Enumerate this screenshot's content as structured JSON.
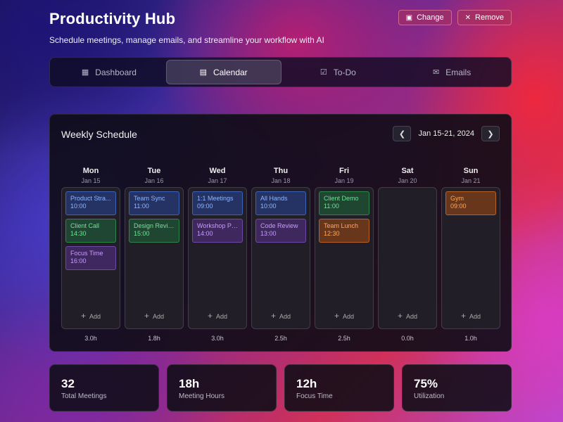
{
  "header": {
    "title": "Productivity Hub",
    "subtitle": "Schedule meetings, manage emails, and streamline your workflow with AI"
  },
  "top_buttons": {
    "change_label": "Change",
    "change_icon": "image-icon",
    "remove_label": "Remove",
    "remove_icon": "close-icon"
  },
  "tabs": [
    {
      "label": "Dashboard",
      "icon": "grid-icon",
      "active": false
    },
    {
      "label": "Calendar",
      "icon": "calendar-icon",
      "active": true
    },
    {
      "label": "To-Do",
      "icon": "checkbox-icon",
      "active": false
    },
    {
      "label": "Emails",
      "icon": "mail-icon",
      "active": false
    }
  ],
  "schedule": {
    "title": "Weekly Schedule",
    "range": "Jan 15-21, 2024",
    "add_label": "Add",
    "days": [
      {
        "name": "Mon",
        "date": "Jan 15",
        "total": "3.0h",
        "events": [
          {
            "name": "Product Stra...",
            "time": "10:00",
            "color": "blue"
          },
          {
            "name": "Client Call",
            "time": "14:30",
            "color": "green"
          },
          {
            "name": "Focus Time",
            "time": "16:00",
            "color": "purple"
          }
        ]
      },
      {
        "name": "Tue",
        "date": "Jan 16",
        "total": "1.8h",
        "events": [
          {
            "name": "Team Sync",
            "time": "11:00",
            "color": "blue"
          },
          {
            "name": "Design Review",
            "time": "15:00",
            "color": "green"
          }
        ]
      },
      {
        "name": "Wed",
        "date": "Jan 17",
        "total": "3.0h",
        "events": [
          {
            "name": "1:1 Meetings",
            "time": "09:00",
            "color": "blue"
          },
          {
            "name": "Workshop Pr...",
            "time": "14:00",
            "color": "purple"
          }
        ]
      },
      {
        "name": "Thu",
        "date": "Jan 18",
        "total": "2.5h",
        "events": [
          {
            "name": "All Hands",
            "time": "10:00",
            "color": "blue"
          },
          {
            "name": "Code Review",
            "time": "13:00",
            "color": "purple"
          }
        ]
      },
      {
        "name": "Fri",
        "date": "Jan 19",
        "total": "2.5h",
        "events": [
          {
            "name": "Client Demo",
            "time": "11:00",
            "color": "green"
          },
          {
            "name": "Team Lunch",
            "time": "12:30",
            "color": "orange"
          }
        ]
      },
      {
        "name": "Sat",
        "date": "Jan 20",
        "total": "0.0h",
        "events": []
      },
      {
        "name": "Sun",
        "date": "Jan 21",
        "total": "1.0h",
        "events": [
          {
            "name": "Gym",
            "time": "09:00",
            "color": "orange"
          }
        ]
      }
    ]
  },
  "stats": [
    {
      "value": "32",
      "label": "Total Meetings"
    },
    {
      "value": "18h",
      "label": "Meeting Hours"
    },
    {
      "value": "12h",
      "label": "Focus Time"
    },
    {
      "value": "75%",
      "label": "Utilization"
    }
  ]
}
